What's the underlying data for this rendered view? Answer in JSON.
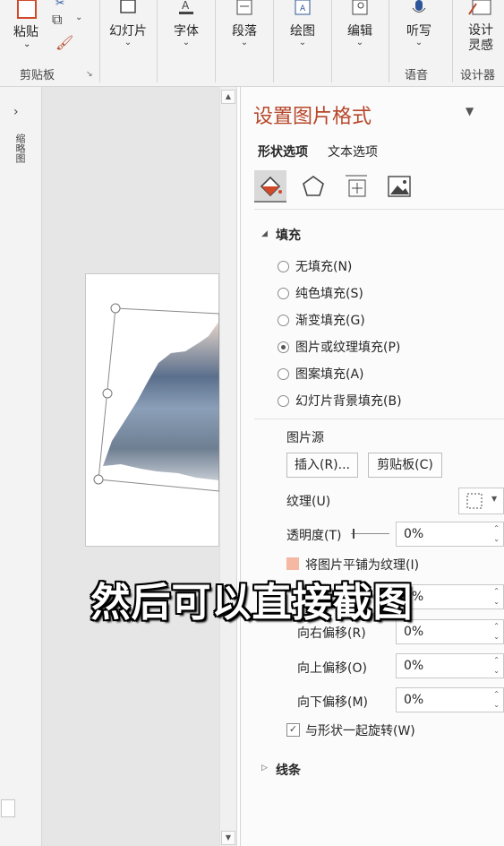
{
  "ribbon": {
    "clipboard": {
      "paste_label": "粘贴",
      "group_label": "剪贴板"
    },
    "buttons": [
      {
        "label": "幻灯片"
      },
      {
        "label": "字体"
      },
      {
        "label": "段落"
      },
      {
        "label": "绘图"
      },
      {
        "label": "编辑"
      },
      {
        "label": "听写"
      },
      {
        "label": "设计\n灵感"
      }
    ],
    "group_voice": "语音",
    "group_designer": "设计器"
  },
  "thumbnails": {
    "label": "缩略图"
  },
  "pane": {
    "title": "设置图片格式",
    "tabs": [
      "形状选项",
      "文本选项"
    ],
    "fill_section": "填充",
    "fill_options": [
      {
        "label": "无填充(N)",
        "selected": false
      },
      {
        "label": "纯色填充(S)",
        "selected": false
      },
      {
        "label": "渐变填充(G)",
        "selected": false
      },
      {
        "label": "图片或纹理填充(P)",
        "selected": true
      },
      {
        "label": "图案填充(A)",
        "selected": false
      },
      {
        "label": "幻灯片背景填充(B)",
        "selected": false
      }
    ],
    "picture_source": "图片源",
    "insert_button": "插入(R)...",
    "clipboard_button": "剪贴板(C)",
    "texture_label": "纹理(U)",
    "transparency_label": "透明度(T)",
    "transparency_value": "0%",
    "tile_label": "将图片平铺为纹理(I)",
    "offset_left_value": "0%",
    "offset_right_label": "向右偏移(R)",
    "offset_right_value": "0%",
    "offset_top_label": "向上偏移(O)",
    "offset_top_value": "0%",
    "offset_bottom_label": "向下偏移(M)",
    "offset_bottom_value": "0%",
    "rotate_label": "与形状一起旋转(W)",
    "rotate_checked": true,
    "line_section": "线条"
  },
  "subtitle": "然后可以直接截图",
  "colors": {
    "accent": "#b7472a",
    "ribbon_bg": "#f3f3f3",
    "pane_bg": "#fbfbfb"
  }
}
